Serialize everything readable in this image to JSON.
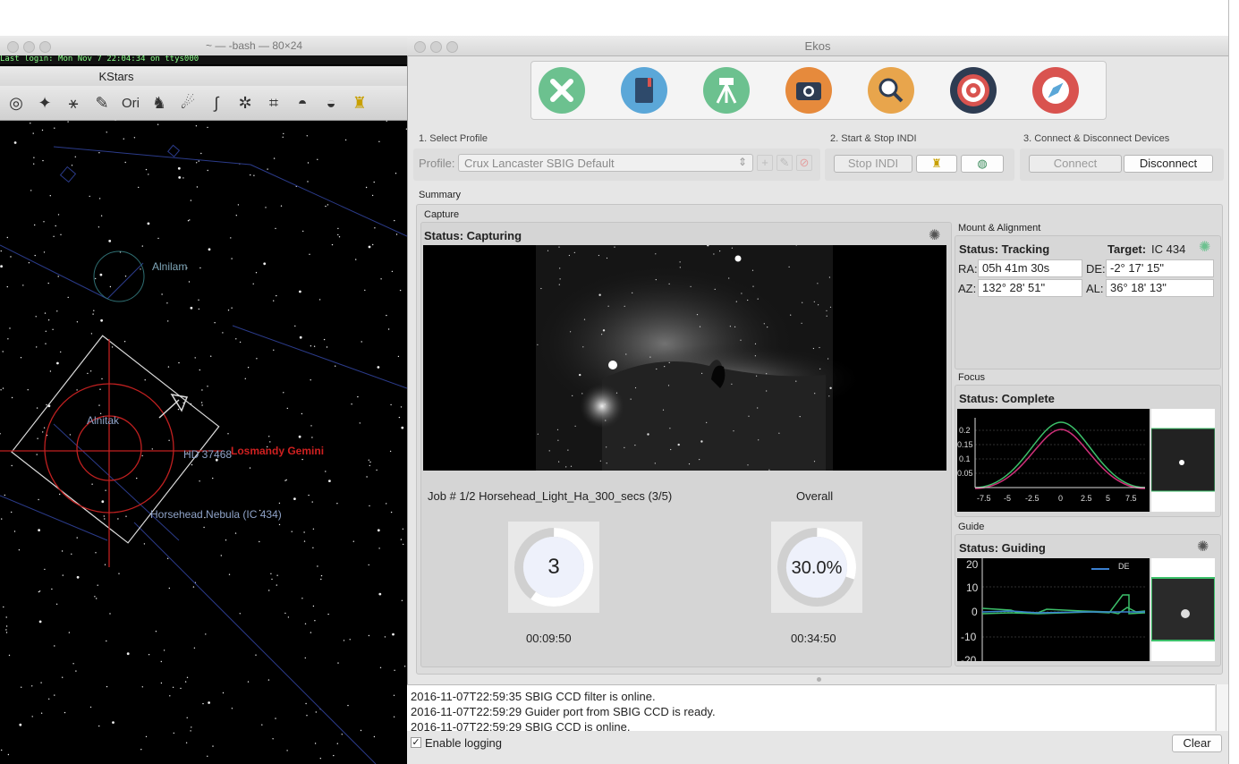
{
  "terminal": {
    "title": "~ — -bash — 80×24",
    "login_line": "Last login: Mon Nov  7 22:04:34 on ttys000"
  },
  "kstars": {
    "title": "KStars",
    "toolbar_icons": [
      "circle-icon",
      "star-icon",
      "constellation-lines-icon",
      "pencil-icon",
      "ori-icon",
      "figure-icon",
      "milky-way-icon",
      "equator-icon",
      "ecliptic-icon",
      "grid-icon",
      "horizon-icon",
      "ground-icon",
      "lamp-icon"
    ],
    "toolbar_text_ori": "Ori",
    "labels": {
      "alnilam": "Alnilam",
      "alnitak": "Alnitak",
      "hd": "HD 37468",
      "scope": "Losmandy Gemini",
      "nebula": "Horsehead Nebula (IC 434)"
    }
  },
  "ekos": {
    "title": "Ekos",
    "module_icons": [
      {
        "name": "setup-tools-icon",
        "color": "#6cc18f"
      },
      {
        "name": "scheduler-book-icon",
        "color": "#5ba7d8"
      },
      {
        "name": "mount-tripod-icon",
        "color": "#6cc18f"
      },
      {
        "name": "capture-camera-icon",
        "color": "#e68a3c"
      },
      {
        "name": "focus-magnifier-icon",
        "color": "#e8a54c"
      },
      {
        "name": "align-target-icon",
        "color": "#2e3c52"
      },
      {
        "name": "guide-compass-icon",
        "color": "#d9534f"
      }
    ],
    "profile": {
      "section": "1. Select Profile",
      "label": "Profile:",
      "value": "Crux Lancaster SBIG Default"
    },
    "indi": {
      "section": "2. Start & Stop INDI",
      "stop_label": "Stop INDI"
    },
    "devices": {
      "section": "3. Connect & Disconnect Devices",
      "connect_label": "Connect",
      "disconnect_label": "Disconnect"
    },
    "summary": {
      "label": "Summary",
      "capture": {
        "group_label": "Capture",
        "status": "Status: Capturing",
        "job": "Job # 1/2 Horsehead_Light_Ha_300_secs (3/5)",
        "overall_label": "Overall",
        "job_progress_value": "3",
        "job_progress_fraction": 0.6,
        "overall_progress_value": "30.0%",
        "overall_progress_fraction": 0.3,
        "job_time": "00:09:50",
        "overall_time": "00:34:50"
      },
      "mount": {
        "group_label": "Mount & Alignment",
        "status": "Status: Tracking",
        "target_label": "Target:",
        "target_value": "IC 434",
        "ra_label": "RA:",
        "ra_value": "05h 41m 30s",
        "de_label": "DE:",
        "de_value": "-2° 17' 15\"",
        "az_label": "AZ:",
        "az_value": "132° 28' 51\"",
        "al_label": "AL:",
        "al_value": "36° 18' 13\""
      },
      "focus": {
        "group_label": "Focus",
        "status": "Status: Complete",
        "y_ticks": [
          "0.2",
          "0.15",
          "0.1",
          "0.05"
        ],
        "x_ticks": [
          "-7.5",
          "-5",
          "-2.5",
          "0",
          "2.5",
          "5",
          "7.5"
        ]
      },
      "guide": {
        "group_label": "Guide",
        "status": "Status: Guiding",
        "legend_de": "DE",
        "y_ticks": [
          "20",
          "10",
          "0",
          "-10",
          "-20"
        ]
      }
    },
    "log": {
      "lines": [
        "2016-11-07T22:59:35 SBIG CCD filter is online.",
        "2016-11-07T22:59:29 Guider port from SBIG CCD is ready.",
        "2016-11-07T22:59:29 SBIG CCD is online."
      ],
      "enable_logging": "Enable logging",
      "clear": "Clear"
    }
  }
}
